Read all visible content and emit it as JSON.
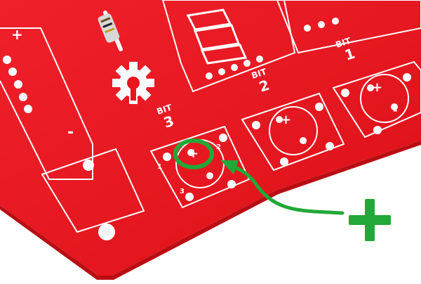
{
  "photo": {
    "board_labels": {
      "bit3_word": "BIT",
      "bit3_num": "3",
      "bit2_word": "BIT",
      "bit2_num": "2",
      "bit1_word": "BIT",
      "bit1_num": "1",
      "battery_plus": "+",
      "battery_minus": "-",
      "pad_1": "1",
      "pad_2": "2",
      "pad_3": "3"
    },
    "annotation": {
      "symbol": "+",
      "color": "#22a838"
    },
    "colors": {
      "board_red": "#e8141e",
      "silkscreen": "#ffffff",
      "background": "#ffffff"
    }
  }
}
